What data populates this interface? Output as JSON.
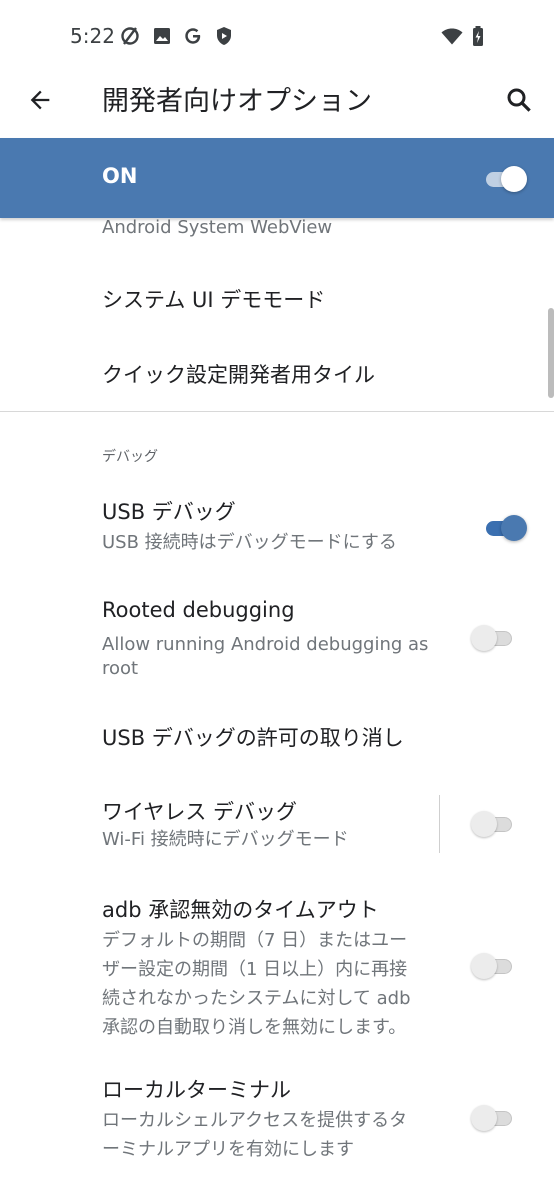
{
  "status_bar": {
    "time": "5:22",
    "icons_left": [
      "no-sync-icon",
      "image-icon",
      "google-icon",
      "shield-icon"
    ],
    "icons_right": [
      "wifi-icon",
      "battery-icon"
    ]
  },
  "app_bar": {
    "title": "開発者向けオプション",
    "back_icon": "arrow-back-icon",
    "search_icon": "search-icon"
  },
  "master_switch": {
    "label": "ON",
    "checked": true
  },
  "items": {
    "webview_summary": "Android System WebView",
    "demo_mode": {
      "title": "システム UI デモモード"
    },
    "quick_tiles": {
      "title": "クイック設定開発者用タイル"
    }
  },
  "debug_section": {
    "category": "デバッグ",
    "usb_debugging": {
      "title": "USB デバッグ",
      "summary": "USB 接続時はデバッグモードにする",
      "checked": true
    },
    "rooted_debugging": {
      "title": "Rooted debugging",
      "summary_lines": [
        "Allow running Android debugging as",
        "root"
      ],
      "checked": false
    },
    "revoke_usb": {
      "title": "USB デバッグの許可の取り消し"
    },
    "wireless_debugging": {
      "title": "ワイヤレス デバッグ",
      "summary": "Wi-Fi 接続時にデバッグモード",
      "checked": false
    },
    "adb_timeout": {
      "title": "adb 承認無効のタイムアウト",
      "summary_lines": [
        "デフォルトの期間（7 日）またはユー",
        "ザー設定の期間（1 日以上）内に再接",
        "続されなかったシステムに対して adb",
        "承認の自動取り消しを無効にします。"
      ],
      "checked": false
    },
    "local_terminal": {
      "title": "ローカルターミナル",
      "summary_lines": [
        "ローカルシェルアクセスを提供するタ",
        "ーミナルアプリを有効にします"
      ],
      "checked": false
    }
  },
  "colors": {
    "accent": "#4a79b0",
    "text_primary": "#202124",
    "text_secondary": "#70757a"
  }
}
